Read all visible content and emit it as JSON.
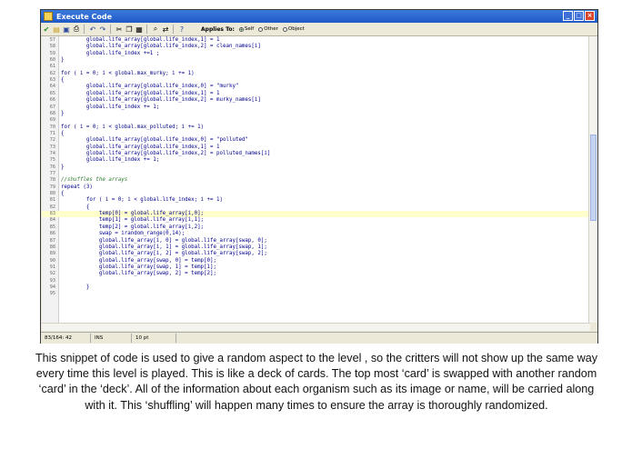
{
  "window": {
    "title": "Execute Code"
  },
  "toolbar": {
    "applies_label": "Applies To:",
    "options": [
      {
        "label": "Self",
        "selected": true
      },
      {
        "label": "Other",
        "selected": false
      },
      {
        "label": "Object",
        "selected": false
      }
    ]
  },
  "code_lines": [
    {
      "num": "57",
      "text": "        global.life_array[global.life_index,1] = 1"
    },
    {
      "num": "58",
      "text": "        global.life_array[global.life_index,2] = clean_names[i]"
    },
    {
      "num": "59",
      "text": "        global.life_index +=1 ;"
    },
    {
      "num": "60",
      "text": "}"
    },
    {
      "num": "61",
      "text": ""
    },
    {
      "num": "62",
      "text": "for ( i = 0; i < global.max_murky; i += 1)"
    },
    {
      "num": "63",
      "text": "{"
    },
    {
      "num": "64",
      "text": "        global.life_array[global.life_index,0] = \"murky\""
    },
    {
      "num": "65",
      "text": "        global.life_array[global.life_index,1] = 1"
    },
    {
      "num": "66",
      "text": "        global.life_array[global.life_index,2] = murky_names[i]"
    },
    {
      "num": "67",
      "text": "        global.life_index += 1;"
    },
    {
      "num": "68",
      "text": "}"
    },
    {
      "num": "69",
      "text": ""
    },
    {
      "num": "70",
      "text": "for ( i = 0; i < global.max_polluted; i += 1)"
    },
    {
      "num": "71",
      "text": "{"
    },
    {
      "num": "72",
      "text": "        global.life_array[global.life_index,0] = \"polluted\""
    },
    {
      "num": "73",
      "text": "        global.life_array[global.life_index,1] = 1"
    },
    {
      "num": "74",
      "text": "        global.life_array[global.life_index,2] = polluted_names[i]"
    },
    {
      "num": "75",
      "text": "        global.life_index += 1;"
    },
    {
      "num": "76",
      "text": "}"
    },
    {
      "num": "77",
      "text": ""
    },
    {
      "num": "78",
      "text": "//shuffles the arrays",
      "comment": true
    },
    {
      "num": "79",
      "text": "repeat (3)"
    },
    {
      "num": "80",
      "text": "{"
    },
    {
      "num": "81",
      "text": "        for ( i = 0; i < global.life_index; i += 1)"
    },
    {
      "num": "82",
      "text": "        {"
    },
    {
      "num": "83",
      "text": "            temp[0] = global.life_array[i,0];",
      "highlight": true
    },
    {
      "num": "84",
      "text": "            temp[1] = global.life_array[i,1];"
    },
    {
      "num": "85",
      "text": "            temp[2] = global.life_array[i,2];"
    },
    {
      "num": "86",
      "text": "            swap = irandom_range(0,14);"
    },
    {
      "num": "87",
      "text": "            global.life_array[i, 0] = global.life_array[swap, 0];"
    },
    {
      "num": "88",
      "text": "            global.life_array[i, 1] = global.life_array[swap, 1];"
    },
    {
      "num": "89",
      "text": "            global.life_array[i, 2] = global.life_array[swap, 2];"
    },
    {
      "num": "90",
      "text": "            global.life_array[swap, 0] = temp[0];"
    },
    {
      "num": "91",
      "text": "            global.life_array[swap, 1] = temp[1];"
    },
    {
      "num": "92",
      "text": "            global.life_array[swap, 2] = temp[2];"
    },
    {
      "num": "93",
      "text": ""
    },
    {
      "num": "94",
      "text": "        }"
    },
    {
      "num": "95",
      "text": ""
    }
  ],
  "status": {
    "position": "83/164: 42",
    "mode": "INS",
    "font_size": "10 pt"
  },
  "caption": "This snippet of code is used to give a random aspect to the level , so the critters will not show up the same way every time this level is played. This is like a deck of cards. The top most ‘card’ is swapped with another random ‘card’ in the ‘deck’. All of the information about each organism such as its image or name, will be carried along with it. This ‘shuffling’ will happen many times to ensure the array is thoroughly randomized."
}
